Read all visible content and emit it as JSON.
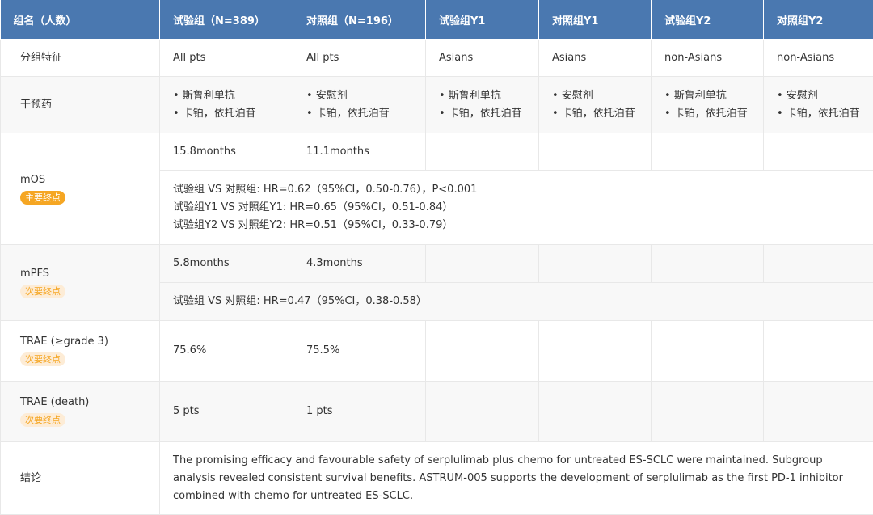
{
  "headers": [
    "组名（人数）",
    "试验组（N=389）",
    "对照组（N=196）",
    "试验组Y1",
    "对照组Y1",
    "试验组Y2",
    "对照组Y2"
  ],
  "rows": {
    "feature": {
      "label": "分组特征",
      "values": [
        "All pts",
        "All pts",
        "Asians",
        "Asians",
        "non-Asians",
        "non-Asians"
      ]
    },
    "intervention": {
      "label": "干预药",
      "exp_line1": "• 斯鲁利单抗",
      "ctl_line1": "• 安慰剂",
      "line2": "• 卡铂，依托泊苷"
    },
    "mos": {
      "label": "mOS",
      "tag": "主要终点",
      "exp": "15.8months",
      "ctl": "11.1months",
      "notes": [
        "试验组 VS 对照组: HR=0.62（95%CI，0.50-0.76），P<0.001",
        "试验组Y1 VS 对照组Y1: HR=0.65（95%CI，0.51-0.84）",
        "试验组Y2 VS 对照组Y2: HR=0.51（95%CI，0.33-0.79）"
      ]
    },
    "mpfs": {
      "label": "mPFS",
      "tag": "次要终点",
      "exp": "5.8months",
      "ctl": "4.3months",
      "note": "试验组 VS 对照组: HR=0.47（95%CI，0.38-0.58）"
    },
    "trae3": {
      "label": "TRAE (≥grade 3)",
      "tag": "次要终点",
      "exp": "75.6%",
      "ctl": "75.5%"
    },
    "traedeath": {
      "label": "TRAE (death)",
      "tag": "次要终点",
      "exp": "5 pts",
      "ctl": "1 pts"
    },
    "conclusion": {
      "label": "结论",
      "text": "The promising efficacy and favourable safety of serplulimab plus chemo for untreated ES-SCLC were maintained. Subgroup analysis revealed consistent survival benefits. ASTRUM-005 supports the development of serplulimab as the first PD-1 inhibitor combined with chemo for untreated ES-SCLC."
    }
  }
}
